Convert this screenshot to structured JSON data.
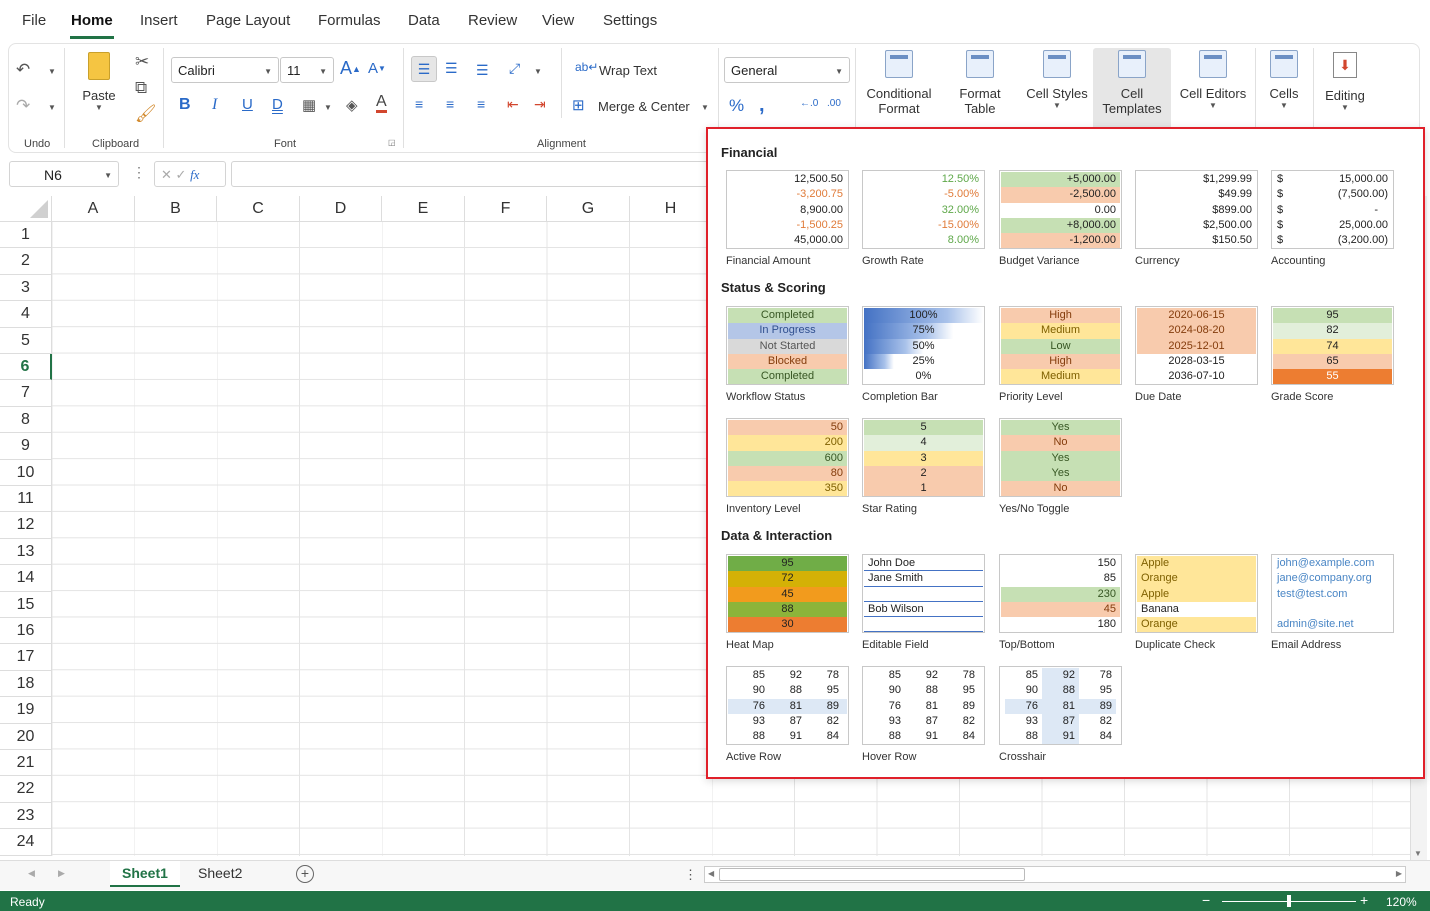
{
  "menu": [
    "File",
    "Home",
    "Insert",
    "Page Layout",
    "Formulas",
    "Data",
    "Review",
    "View",
    "Settings"
  ],
  "active_menu": "Home",
  "ribbon": {
    "groups": [
      "Undo",
      "Clipboard",
      "Font",
      "Alignment"
    ],
    "paste_label": "Paste",
    "font_name": "Calibri",
    "font_size": "11",
    "wrap_text": "Wrap Text",
    "merge_center": "Merge & Center",
    "number_format": "General",
    "conditional_format": [
      "Conditional",
      "Format"
    ],
    "format_table": [
      "Format",
      "Table"
    ],
    "cell_styles": "Cell Styles",
    "cell_templates": [
      "Cell",
      "Templates"
    ],
    "cell_editors": "Cell Editors",
    "cells": "Cells",
    "editing": "Editing"
  },
  "formula_bar": {
    "name_box": "N6",
    "fx": "fx"
  },
  "columns": [
    "A",
    "B",
    "C",
    "D",
    "E",
    "F",
    "G",
    "H"
  ],
  "rows": [
    "1",
    "2",
    "3",
    "4",
    "5",
    "6",
    "7",
    "8",
    "9",
    "10",
    "11",
    "12",
    "13",
    "14",
    "15",
    "16",
    "17",
    "18",
    "19",
    "20",
    "21",
    "22",
    "23",
    "24"
  ],
  "active_row": "6",
  "sheets": [
    "Sheet1",
    "Sheet2"
  ],
  "active_sheet": "Sheet1",
  "status": {
    "ready": "Ready",
    "zoom": "120%"
  },
  "colors": {
    "accent": "#217346",
    "highlight_border": "#e0202a",
    "green_fill": "#c6e0b4",
    "orange_fill": "#f8cbad",
    "yellow_fill": "#ffe699",
    "blue_fill": "#b4c6e7",
    "gray_fill": "#d9d9d9"
  },
  "panel": {
    "sections": [
      "Financial",
      "Status & Scoring",
      "Data & Interaction"
    ],
    "financial": {
      "amount": {
        "label": "Financial Amount",
        "values": [
          "12,500.50",
          "-3,200.75",
          "8,900.00",
          "-1,500.25",
          "45,000.00"
        ]
      },
      "growth": {
        "label": "Growth Rate",
        "values": [
          "12.50%",
          "-5.00%",
          "32.00%",
          "-15.00%",
          "8.00%"
        ]
      },
      "budget": {
        "label": "Budget Variance",
        "values": [
          "+5,000.00",
          "-2,500.00",
          "0.00",
          "+8,000.00",
          "-1,200.00"
        ]
      },
      "currency": {
        "label": "Currency",
        "values": [
          "$1,299.99",
          "$49.99",
          "$899.00",
          "$2,500.00",
          "$150.50"
        ]
      },
      "accounting": {
        "label": "Accounting",
        "symbol": "$",
        "values": [
          "15,000.00",
          "(7,500.00)",
          "-",
          "25,000.00",
          "(3,200.00)"
        ]
      }
    },
    "status": {
      "workflow": {
        "label": "Workflow Status",
        "values": [
          "Completed",
          "In Progress",
          "Not Started",
          "Blocked",
          "Completed"
        ]
      },
      "completion": {
        "label": "Completion Bar",
        "values": [
          "100%",
          "75%",
          "50%",
          "25%",
          "0%"
        ],
        "levels": [
          1.0,
          0.75,
          0.5,
          0.25,
          0
        ]
      },
      "priority": {
        "label": "Priority Level",
        "values": [
          "High",
          "Medium",
          "Low",
          "High",
          "Medium"
        ]
      },
      "due": {
        "label": "Due Date",
        "values": [
          "2020-06-15",
          "2024-08-20",
          "2025-12-01",
          "2028-03-15",
          "2036-07-10"
        ]
      },
      "grade": {
        "label": "Grade Score",
        "values": [
          "95",
          "82",
          "74",
          "65",
          "55"
        ]
      },
      "inventory": {
        "label": "Inventory Level",
        "values": [
          "50",
          "200",
          "600",
          "80",
          "350"
        ]
      },
      "star": {
        "label": "Star Rating",
        "values": [
          "5",
          "4",
          "3",
          "2",
          "1"
        ]
      },
      "yesno": {
        "label": "Yes/No Toggle",
        "values": [
          "Yes",
          "No",
          "Yes",
          "Yes",
          "No"
        ]
      }
    },
    "data": {
      "heatmap": {
        "label": "Heat Map",
        "values": [
          "95",
          "72",
          "45",
          "88",
          "30"
        ]
      },
      "editable": {
        "label": "Editable Field",
        "values": [
          "John Doe",
          "Jane Smith",
          "",
          "Bob Wilson",
          ""
        ]
      },
      "topbottom": {
        "label": "Top/Bottom",
        "values": [
          "150",
          "85",
          "230",
          "45",
          "180"
        ]
      },
      "duplicate": {
        "label": "Duplicate Check",
        "values": [
          "Apple",
          "Orange",
          "Apple",
          "Banana",
          "Orange"
        ]
      },
      "email": {
        "label": "Email Address",
        "values": [
          "john@example.com",
          "jane@company.org",
          "test@test.com",
          "",
          "admin@site.net"
        ]
      },
      "active_row": {
        "label": "Active Row",
        "rows": [
          [
            "85",
            "92",
            "78"
          ],
          [
            "90",
            "88",
            "95"
          ],
          [
            "76",
            "81",
            "89"
          ],
          [
            "93",
            "87",
            "82"
          ],
          [
            "88",
            "91",
            "84"
          ]
        ]
      },
      "hover_row": {
        "label": "Hover Row",
        "rows": [
          [
            "85",
            "92",
            "78"
          ],
          [
            "90",
            "88",
            "95"
          ],
          [
            "76",
            "81",
            "89"
          ],
          [
            "93",
            "87",
            "82"
          ],
          [
            "88",
            "91",
            "84"
          ]
        ]
      },
      "crosshair": {
        "label": "Crosshair",
        "rows": [
          [
            "85",
            "92",
            "78"
          ],
          [
            "90",
            "88",
            "95"
          ],
          [
            "76",
            "81",
            "89"
          ],
          [
            "93",
            "87",
            "82"
          ],
          [
            "88",
            "91",
            "84"
          ]
        ]
      }
    }
  }
}
